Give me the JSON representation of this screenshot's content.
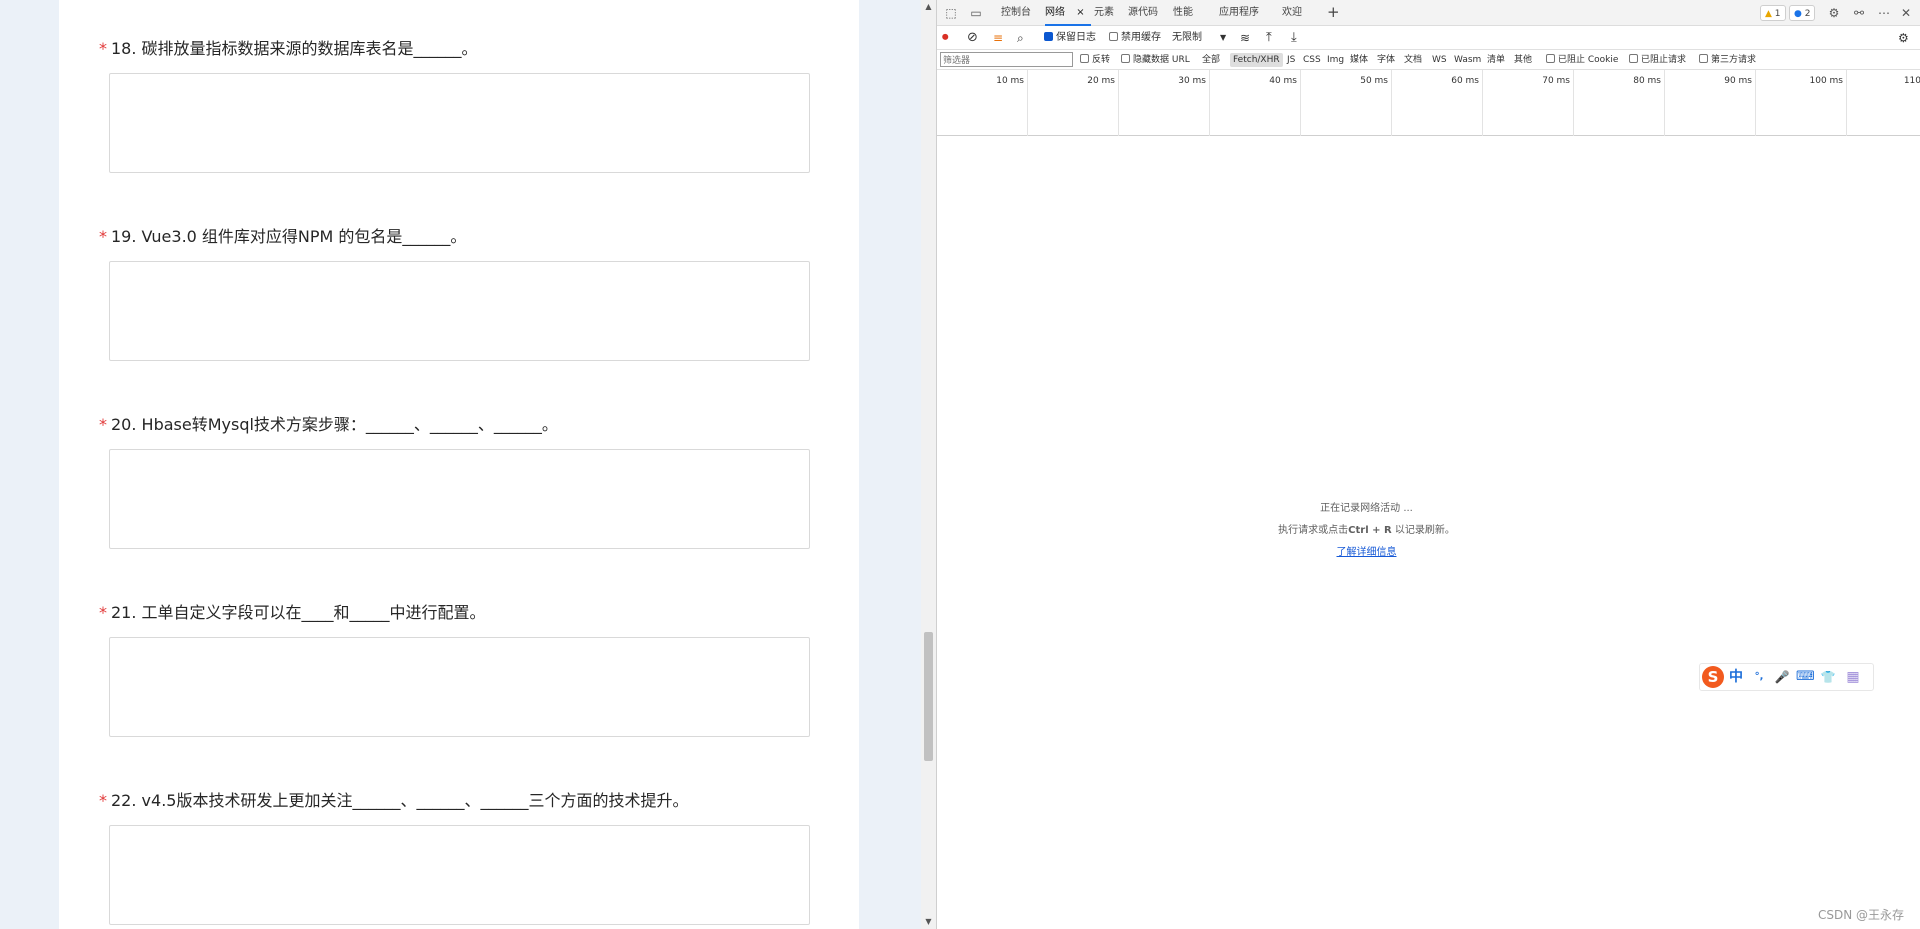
{
  "form": {
    "questions": [
      {
        "number": "18.",
        "text": "碳排放量指标数据来源的数据库表名是______。"
      },
      {
        "number": "19.",
        "text": "Vue3.0 组件库对应得NPM 的包名是______。"
      },
      {
        "number": "20.",
        "text": "Hbase转Mysql技术方案步骤：______、______、______。"
      },
      {
        "number": "21.",
        "text": "工单自定义字段可以在____和_____中进行配置。"
      },
      {
        "number": "22.",
        "text": "v4.5版本技术研发上更加关注______、______、______三个方面的技术提升。"
      }
    ],
    "required_mark": "*"
  },
  "scrollbar": {
    "up_arrow": "▲",
    "down_arrow": "▼"
  },
  "devtools": {
    "tabs": {
      "console": "控制台",
      "network": "网络",
      "close": "×",
      "elements": "元素",
      "sources": "源代码",
      "performance": "性能",
      "application": "应用程序",
      "welcome": "欢迎",
      "add": "+"
    },
    "badges": {
      "warnings": "1",
      "issues": "2"
    },
    "toolbar": {
      "preserve_log": "保留日志",
      "disable_cache": "禁用缓存",
      "throttling": "无限制"
    },
    "filter": {
      "placeholder": "筛选器",
      "invert": "反转",
      "hide_data_urls": "隐藏数据 URL",
      "all": "全部",
      "fetch_xhr": "Fetch/XHR",
      "js": "JS",
      "css": "CSS",
      "img": "Img",
      "media": "媒体",
      "font": "字体",
      "doc": "文档",
      "ws": "WS",
      "wasm": "Wasm",
      "manifest": "清单",
      "other": "其他",
      "blocked_cookies": "已阻止 Cookie",
      "blocked_requests": "已阻止请求",
      "third_party": "第三方请求"
    },
    "timeline_ticks": [
      "10 ms",
      "20 ms",
      "30 ms",
      "40 ms",
      "50 ms",
      "60 ms",
      "70 ms",
      "80 ms",
      "90 ms",
      "100 ms",
      "110"
    ],
    "empty_state": {
      "line1": "正在记录网络活动 ...",
      "line2_prefix": "执行请求或点击",
      "line2_shortcut": "Ctrl + R",
      "line2_suffix": "以记录刷新。",
      "link": "了解详细信息"
    }
  },
  "ime": {
    "lang": "中",
    "punct": "°,",
    "voice": "🎤",
    "keyboard": "⌨",
    "skin": "👕",
    "tools": "▦"
  },
  "watermark": "CSDN @王永存"
}
